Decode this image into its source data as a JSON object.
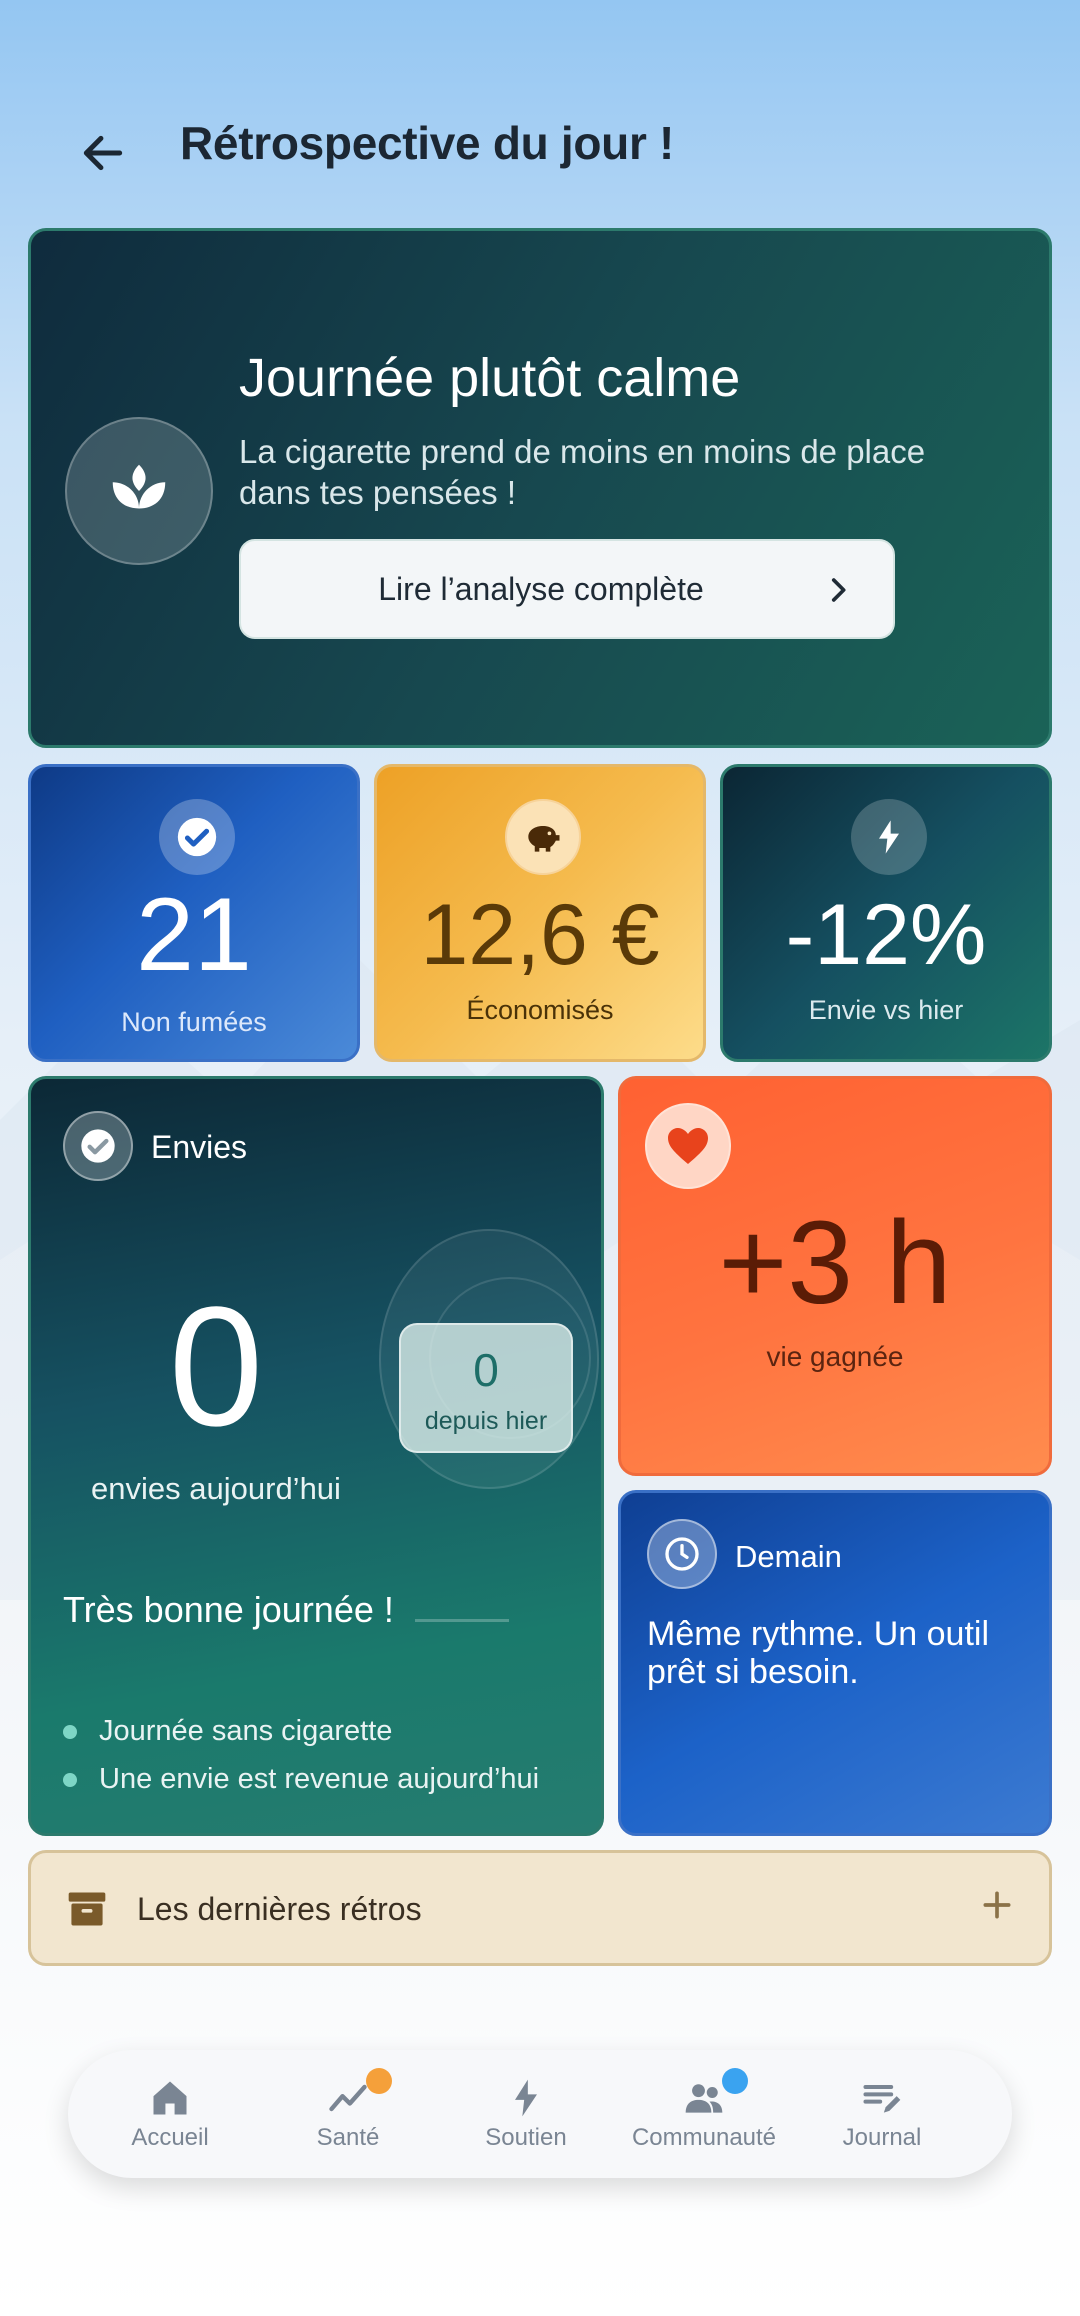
{
  "header": {
    "title": "Rétrospective du jour !"
  },
  "hero": {
    "title": "Journée plutôt calme",
    "subtitle": "La cigarette prend de moins en moins de place dans tes pensées !",
    "button_label": "Lire l’analyse complète",
    "icon": "sprout-icon"
  },
  "stats": [
    {
      "value": "21",
      "label": "Non fumées",
      "icon": "check-circle-icon"
    },
    {
      "value": "12,6 €",
      "label": "Économisés",
      "icon": "piggy-bank-icon"
    },
    {
      "value": "-12%",
      "label": "Envie vs hier",
      "icon": "bolt-icon"
    }
  ],
  "envies": {
    "title": "Envies",
    "count": "0",
    "count_label": "envies aujourd’hui",
    "since_value": "0",
    "since_label": "depuis hier",
    "message": "Très bonne journée !",
    "bullets": [
      "Journée sans cigarette",
      "Une envie est revenue aujourd’hui"
    ]
  },
  "life": {
    "value": "+3 h",
    "label": "vie gagnée",
    "icon": "heart-icon"
  },
  "tomorrow": {
    "title": "Demain",
    "text": "Même rythme. Un outil prêt si besoin.",
    "icon": "clock-icon"
  },
  "retros": {
    "label": "Les dernières rétros"
  },
  "nav": {
    "items": [
      {
        "label": "Accueil",
        "icon": "home-icon"
      },
      {
        "label": "Santé",
        "icon": "trend-icon",
        "badge_color": "#f5a03a"
      },
      {
        "label": "Soutien",
        "icon": "bolt-icon"
      },
      {
        "label": "Communauté",
        "icon": "people-icon",
        "badge_color": "#3aa3f0"
      },
      {
        "label": "Journal",
        "icon": "journal-edit-icon"
      }
    ]
  },
  "colors": {
    "accent_green": "#1a6357",
    "accent_blue": "#1f5fc1",
    "accent_orange": "#ff6132",
    "accent_gold": "#f5bb4e"
  }
}
